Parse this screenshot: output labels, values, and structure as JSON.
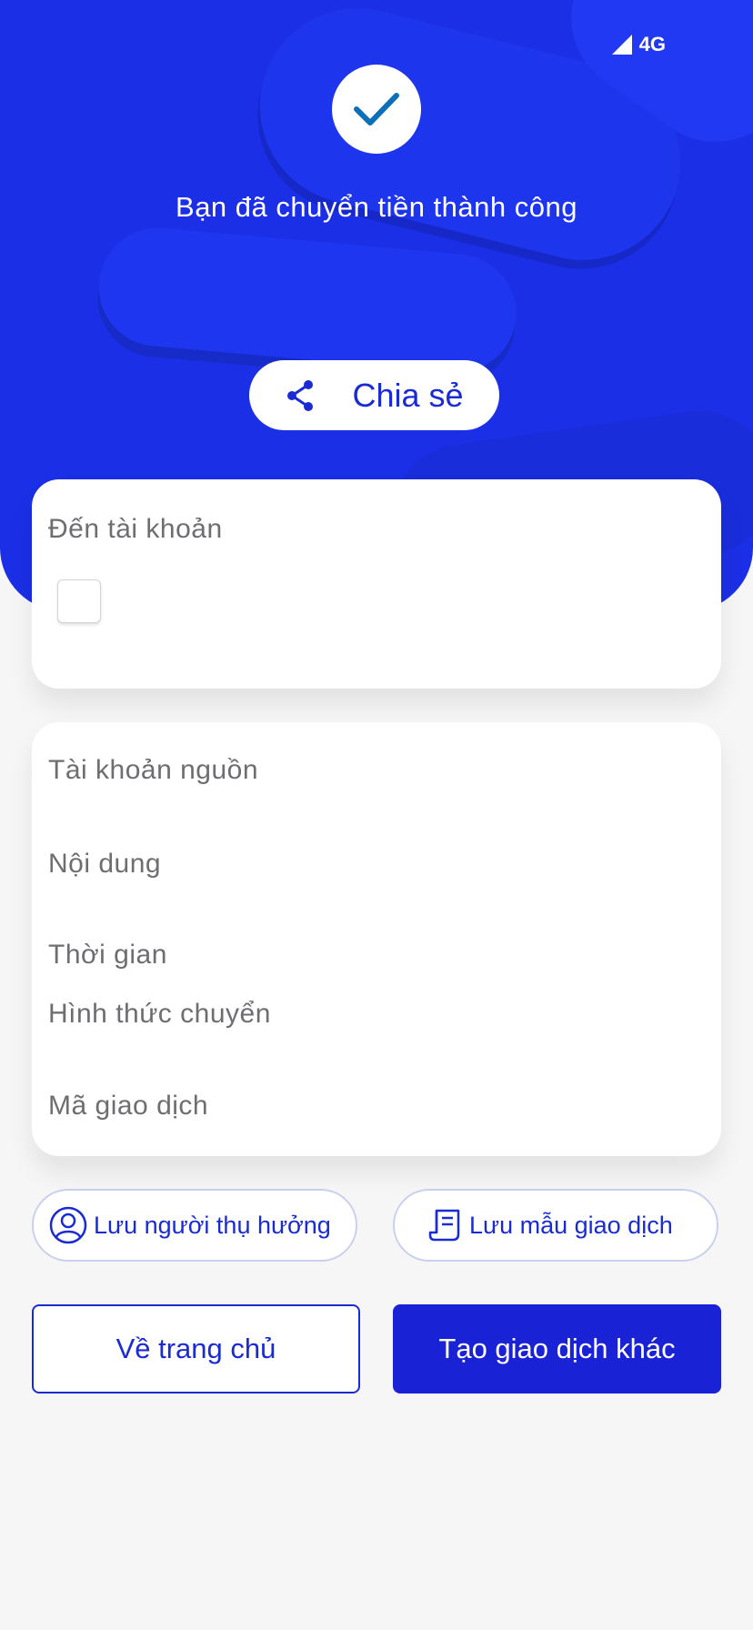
{
  "status_bar": {
    "network": "4G"
  },
  "hero": {
    "title": "Bạn đã chuyển tiền thành công",
    "share_label": "Chia sẻ"
  },
  "recipient_card": {
    "label": "Đến tài khoản"
  },
  "details_card": {
    "fields": [
      {
        "label": "Tài khoản nguồn"
      },
      {
        "label": "Nội dung"
      },
      {
        "label": "Thời gian"
      },
      {
        "label": "Hình thức chuyển"
      },
      {
        "label": "Mã giao dịch"
      }
    ]
  },
  "actions": {
    "save_beneficiary": "Lưu người thụ hưởng",
    "save_template": "Lưu mẫu giao dịch",
    "home": "Về trang chủ",
    "new_transaction": "Tạo giao dịch khác"
  },
  "colors": {
    "primary": "#1b2fe6",
    "accent": "#1a2bd4",
    "check": "#0d6fb8"
  }
}
